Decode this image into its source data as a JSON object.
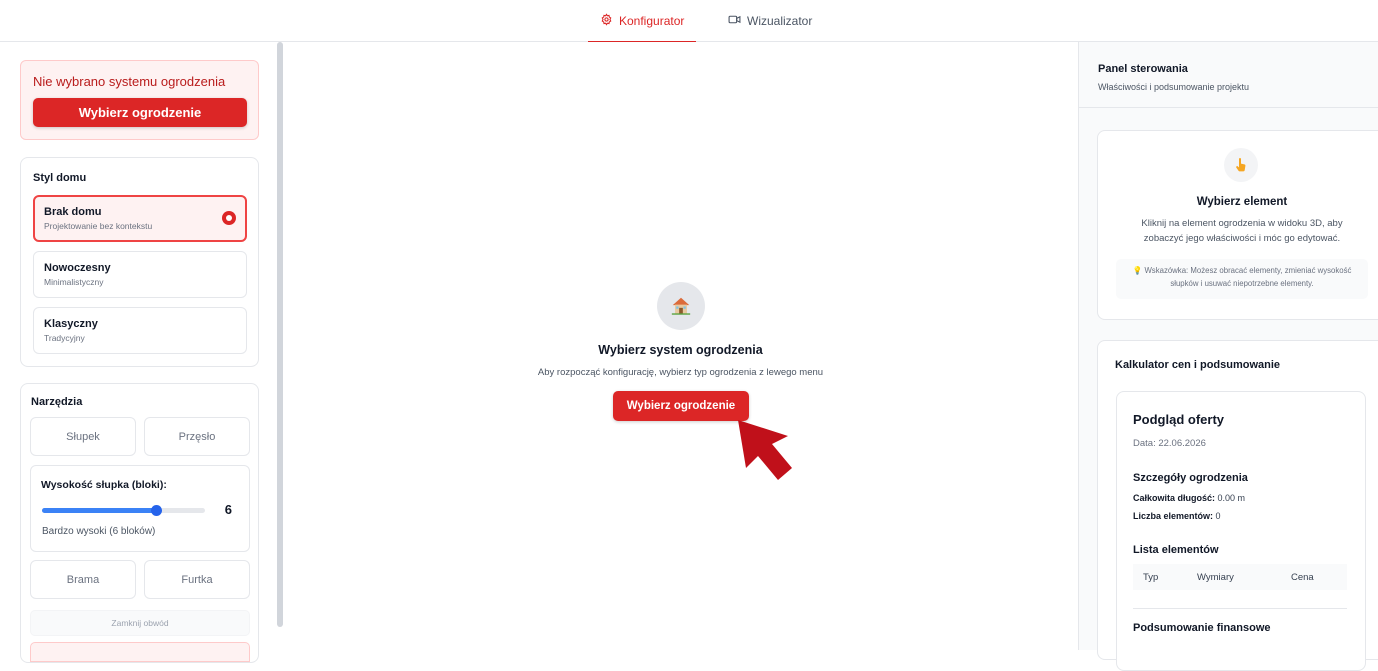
{
  "tabs": [
    {
      "label": "Konfigurator",
      "active": true
    },
    {
      "label": "Wizualizator",
      "active": false
    }
  ],
  "left": {
    "alert_text": "Nie wybrano systemu ogrodzenia",
    "alert_button": "Wybierz ogrodzenie",
    "house_style": {
      "title": "Styl domu",
      "options": [
        {
          "title": "Brak domu",
          "subtitle": "Projektowanie bez kontekstu",
          "selected": true
        },
        {
          "title": "Nowoczesny",
          "subtitle": "Minimalistyczny",
          "selected": false
        },
        {
          "title": "Klasyczny",
          "subtitle": "Tradycyjny",
          "selected": false
        }
      ]
    },
    "tools": {
      "title": "Narzędzia",
      "post": "Słupek",
      "span": "Przęsło",
      "slider_label": "Wysokość słupka (bloki):",
      "slider_value": "6",
      "slider_fraction": 0.7,
      "slider_desc": "Bardzo wysoki (6 bloków)",
      "gate": "Brama",
      "wicket": "Furtka",
      "close_loop": "Zamknij obwód"
    }
  },
  "center": {
    "title": "Wybierz system ogrodzenia",
    "subtitle": "Aby rozpocząć konfigurację, wybierz typ ogrodzenia z lewego menu",
    "button": "Wybierz ogrodzenie"
  },
  "right": {
    "title": "Panel sterowania",
    "subtitle": "Właściwości i podsumowanie projektu",
    "select": {
      "title": "Wybierz element",
      "description": "Kliknij na element ogrodzenia w widoku 3D, aby zobaczyć jego właściwości i móc go edytować.",
      "hint": "Wskazówka: Możesz obracać elementy, zmieniać wysokość słupków i usuwać niepotrzebne elementy."
    },
    "calculator": {
      "title": "Kalkulator cen i podsumowanie",
      "offer_title": "Podgląd oferty",
      "date": "Data: 22.06.2026",
      "details_title": "Szczegóły ogrodzenia",
      "total_length_label": "Całkowita długość:",
      "total_length_value": "0.00 m",
      "elements_count_label": "Liczba elementów:",
      "elements_count_value": "0",
      "list_title": "Lista elementów",
      "columns": [
        "Typ",
        "Wymiary",
        "Cena"
      ],
      "finance_title": "Podsumowanie finansowe"
    }
  },
  "colors": {
    "accent": "#dc2626",
    "slider": "#2563eb"
  }
}
